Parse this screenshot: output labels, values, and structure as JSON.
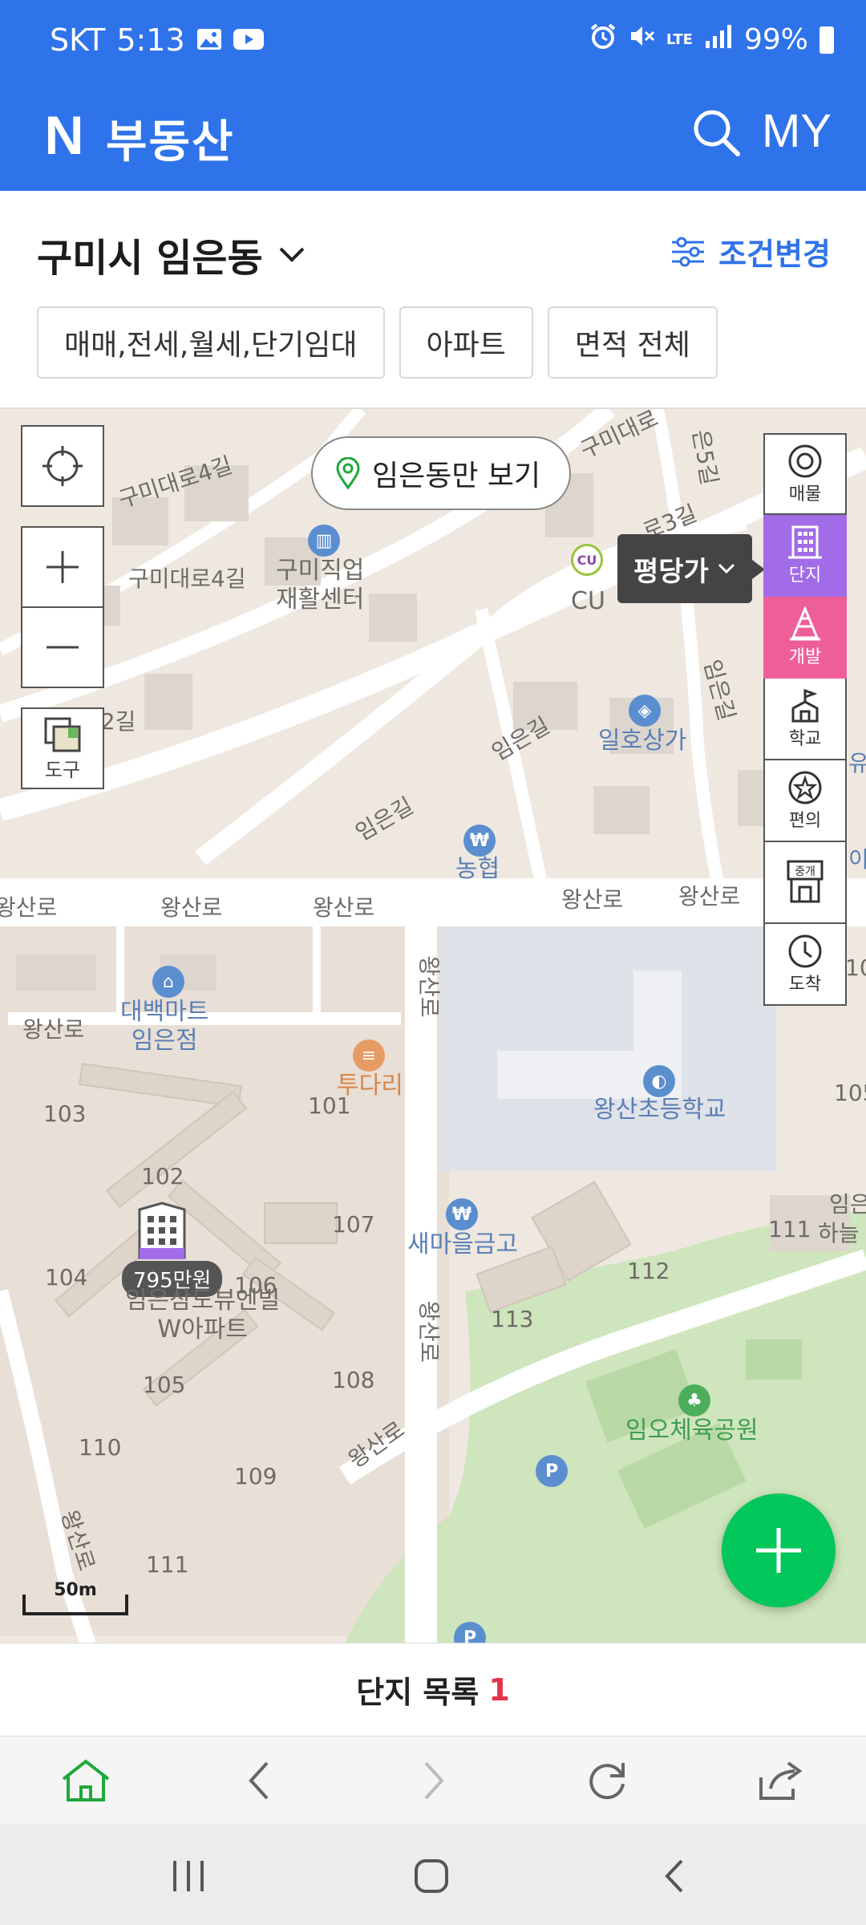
{
  "status_bar": {
    "carrier": "SKT",
    "time": "5:13",
    "network": "LTE",
    "battery": "99%"
  },
  "header": {
    "logo": "N",
    "title": "부동산",
    "my_label": "MY"
  },
  "region": {
    "name": "구미시 임은동",
    "condition_button": "조건변경"
  },
  "filters": [
    "매매,전세,월세,단기임대",
    "아파트",
    "면적 전체"
  ],
  "map": {
    "only_button": "임은동만 보기",
    "price_type": "평당가",
    "tool_label": "도구",
    "side_tools": [
      "매물",
      "단지",
      "개발",
      "학교",
      "편의",
      "중개",
      "도착"
    ],
    "streets": [
      "구미대로4길",
      "구미대로4길",
      "구미대로",
      "은5길",
      "로3길",
      "임은길",
      "임은길",
      "임은길",
      "로2길",
      "왕산로",
      "왕산로",
      "왕산로",
      "왕산로",
      "왕산로",
      "왕산로",
      "왕산로",
      "왕산로",
      "왕산로",
      "왕산로"
    ],
    "pois": {
      "center": "구미직업\n재활센터",
      "cu": "CU",
      "mall": "일호상가",
      "nh": "농협",
      "mart": "대백마트\n임은점",
      "tudari": "투다리",
      "school": "왕산초등학교",
      "bank": "새마을금고",
      "park": "임오체육공원",
      "right_edge_1": "임은",
      "right_edge_2": "하늘",
      "right_edge_3": "유",
      "right_edge_4": "이",
      "right_edge_5": "10",
      "right_edge_6": "105"
    },
    "buildings": [
      "103",
      "101",
      "102",
      "107",
      "104",
      "106",
      "105",
      "108",
      "110",
      "109",
      "111",
      "111",
      "112",
      "113"
    ],
    "marker": {
      "price": "795만원",
      "apt_name": "임은삼도뷰엔빌\nW아파트"
    },
    "scale": "50m"
  },
  "list_bar": {
    "label": "단지 목록",
    "count": "1"
  }
}
